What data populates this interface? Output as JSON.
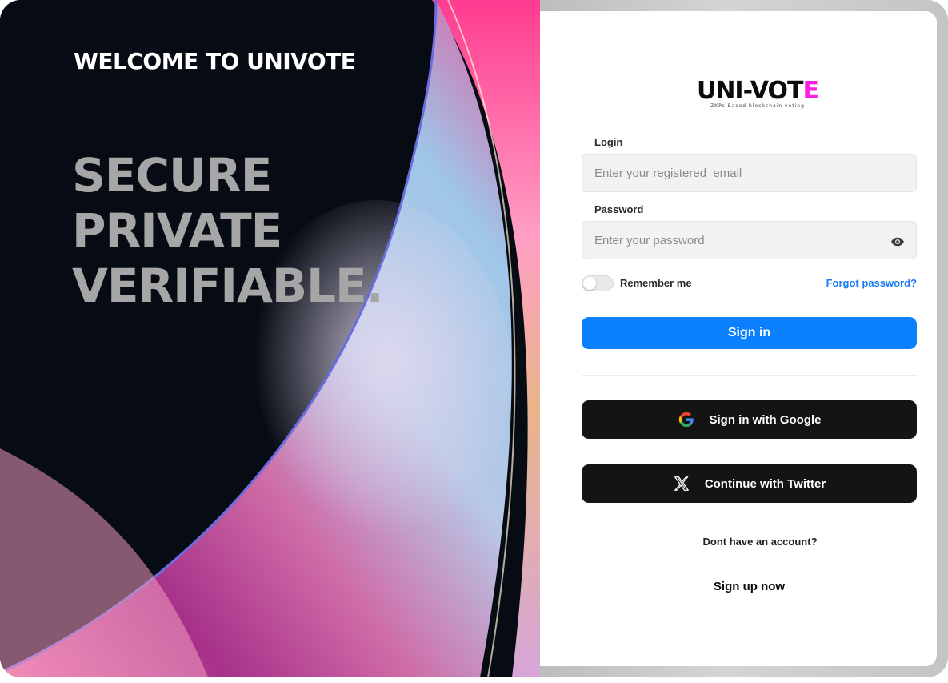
{
  "hero": {
    "title": "WELCOME TO UNIVOTE",
    "lines": [
      "SECURE",
      "PRIVATE",
      "VERIFIABLE."
    ]
  },
  "logo": {
    "main": "UNI-VOT",
    "accent": "E",
    "tagline": "ZKPs Based blockchain voting",
    "accent_color": "#ff1fe0"
  },
  "form": {
    "login_label": "Login",
    "login_placeholder": "Enter your registered  email",
    "password_label": "Password",
    "password_placeholder": "Enter your password",
    "remember_label": "Remember me",
    "remember_checked": false,
    "forgot_label": "Forgot password?",
    "sign_in_label": "Sign in"
  },
  "social": {
    "google_label": "Sign in with Google",
    "twitter_label": "Continue with Twitter"
  },
  "footer": {
    "no_account": "Dont have an account?",
    "signup_label": "Sign up now"
  },
  "icons": {
    "eye": "eye-icon",
    "google": "google-icon",
    "x": "x-logo-icon"
  },
  "colors": {
    "primary": "#0a80ff",
    "link": "#1a7cf5",
    "dark_button": "#141414",
    "hero_text": "#a6a6a6"
  }
}
